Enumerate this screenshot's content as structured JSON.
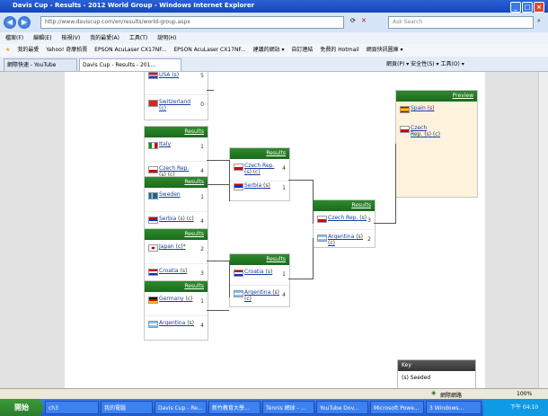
{
  "window": {
    "title": "Davis Cup - Results - 2012 World Group - Windows Internet Explorer"
  },
  "address": {
    "url": "http://www.daviscup.com/en/results/world-group.aspx",
    "search_placeholder": "Ask Search"
  },
  "menu": [
    "檔案(F)",
    "編輯(E)",
    "檢視(V)",
    "我的最愛(A)",
    "工具(T)",
    "說明(H)"
  ],
  "favorites": [
    "我的最愛",
    "Yahoo! 奇摩拍賣",
    "EPSON AcuLaser CX17NF...",
    "EPSON AcuLaser CX17NF...",
    "建議的網站 ▾",
    "自訂連結",
    "免費的 Hotmail",
    "網頁快訊圖庫 ▾"
  ],
  "tabs": [
    "網際快速 - YouTube",
    "Davis Cup - Results - 201..."
  ],
  "toolbar_right": "網頁(P) ▾  安全性(S) ▾  工具(O) ▾",
  "bracket": {
    "results_label": "Results",
    "preview_label": "Preview",
    "top_partial": [
      {
        "name": "USA (s)",
        "score": "5"
      },
      {
        "name": "Switzerland (c)",
        "score": "0"
      }
    ],
    "r1": [
      {
        "players": [
          {
            "name": "Italy",
            "sub": "",
            "score": "1"
          },
          {
            "name": "Czech Rep.",
            "sub": "(s) (c)",
            "score": "4"
          }
        ]
      },
      {
        "players": [
          {
            "name": "Sweden",
            "sub": "",
            "score": "1"
          },
          {
            "name": "Serbia",
            "sub": "(s) (c)",
            "score": "4"
          }
        ]
      },
      {
        "players": [
          {
            "name": "Japan",
            "sub": "(c)*",
            "score": "2"
          },
          {
            "name": "Croatia",
            "sub": "(s)",
            "score": "3"
          }
        ]
      },
      {
        "players": [
          {
            "name": "Germany",
            "sub": "(c)",
            "score": "1"
          },
          {
            "name": "Argentina",
            "sub": "(s)",
            "score": "4"
          }
        ]
      }
    ],
    "r2": [
      {
        "players": [
          {
            "name": "Czech Rep.",
            "sub": "(s) (c)",
            "score": "4"
          },
          {
            "name": "Serbia",
            "sub": "(s)",
            "score": "1"
          }
        ]
      },
      {
        "players": [
          {
            "name": "Croatia",
            "sub": "(s)",
            "score": "1"
          },
          {
            "name": "Argentina",
            "sub": "(s) (c)",
            "score": "4"
          }
        ]
      }
    ],
    "sf": {
      "players": [
        {
          "name": "Czech Rep.",
          "sub": "(s)",
          "score": "3"
        },
        {
          "name": "Argentina",
          "sub": "(s) (c)",
          "score": "2"
        }
      ]
    },
    "final": {
      "players": [
        {
          "name": "Spain",
          "sub": "(s)",
          "score": ""
        },
        {
          "name": "Czech",
          "sub": "Rep. (s) (c)",
          "score": ""
        }
      ]
    }
  },
  "key": {
    "title": "Key",
    "item": "(s) Seeded"
  },
  "statusbar": {
    "zone": "網際網路",
    "zoom": "100%"
  },
  "taskbar": {
    "start": "開始",
    "buttons": [
      "ch3",
      "我的電腦",
      "Davis Cup - Re...",
      "新竹教育大學...",
      "Tennis 網球 - ...",
      "YouTube Dov...",
      "Microsoft Powe...",
      "3 Windows..."
    ],
    "clock": "下午 04:10"
  },
  "colors": {
    "header_green": "#1b6b1b",
    "link_blue": "#1a3c9c",
    "final_bg": "#fdf3dc"
  }
}
